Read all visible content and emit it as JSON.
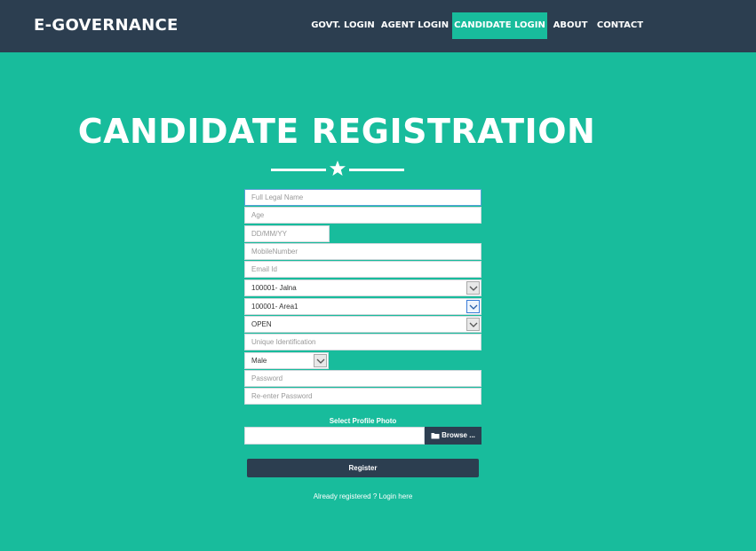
{
  "brand": "E-GOVERNANCE",
  "nav": [
    {
      "label": "GOVT. LOGIN",
      "active": false
    },
    {
      "label": "AGENT LOGIN",
      "active": false
    },
    {
      "label": "CANDIDATE LOGIN",
      "active": true
    },
    {
      "label": "ABOUT",
      "active": false
    },
    {
      "label": "CONTACT",
      "active": false
    }
  ],
  "page_title": "CANDIDATE REGISTRATION",
  "form": {
    "full_name_placeholder": "Full Legal Name",
    "age_placeholder": "Age",
    "dob_placeholder": "DD/MM/YY",
    "mobile_placeholder": "MobileNumber",
    "email_placeholder": "Email Id",
    "district_value": "100001- Jalna",
    "area_value": "100001- Area1",
    "category_value": "OPEN",
    "unique_id_placeholder": "Unique Identification",
    "gender_value": "Male",
    "password_placeholder": "Password",
    "reenter_password_placeholder": "Re-enter Password",
    "photo_label": "Select Profile Photo",
    "browse_label": "Browse ...",
    "register_label": "Register",
    "login_link": "Already registered ? Login here"
  },
  "colors": {
    "primary": "#2c3e50",
    "accent": "#18bc9c"
  },
  "icons": {
    "divider": "star-icon",
    "browse": "folder-icon",
    "select": "chevron-down-icon"
  }
}
